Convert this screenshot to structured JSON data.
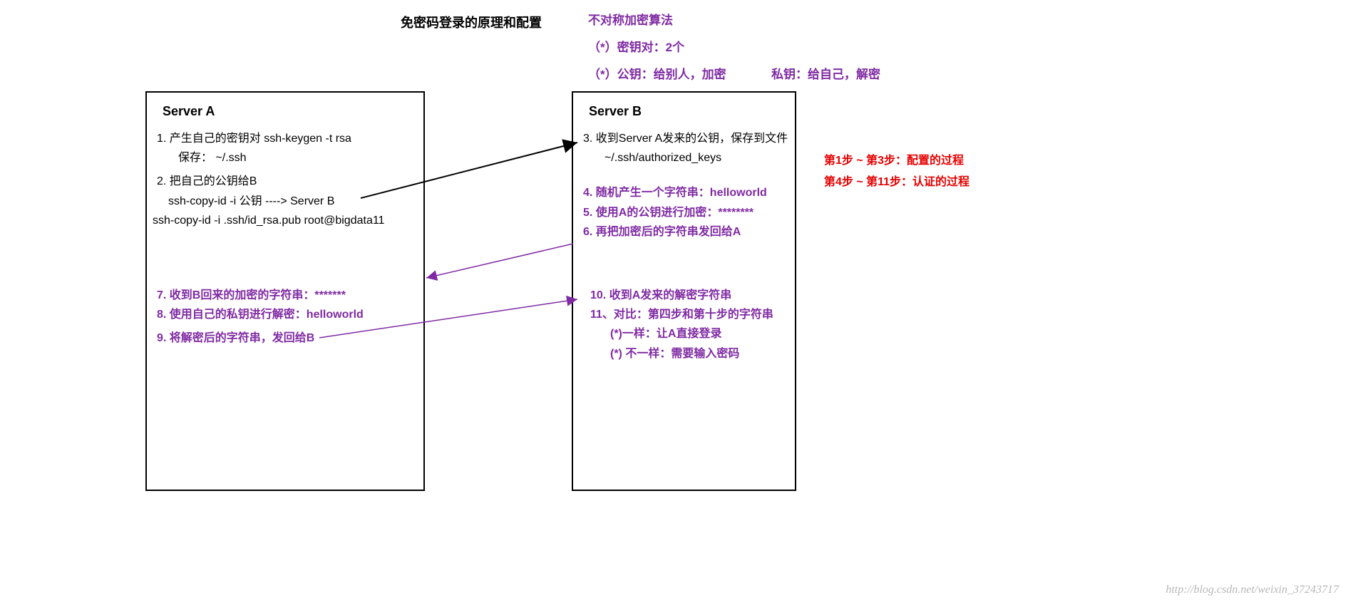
{
  "title": "免密码登录的原理和配置",
  "top_notes": {
    "line1": "不对称加密算法",
    "line2": "（*）密钥对：2个",
    "line3a": "（*）公钥：给别人，加密",
    "line3b": "私钥：给自己，解密"
  },
  "server_a": {
    "title": "Server A",
    "s1": "1. 产生自己的密钥对 ssh-keygen -t rsa",
    "s1a": "保存：  ~/.ssh",
    "s2": "2. 把自己的公钥给B",
    "s2a": "ssh-copy-id -i 公钥 ---->   Server B",
    "s2b": "ssh-copy-id -i .ssh/id_rsa.pub root@bigdata11",
    "s7": "7. 收到B回来的加密的字符串：*******",
    "s8": "8. 使用自己的私钥进行解密：helloworld",
    "s9": "9. 将解密后的字符串，发回给B"
  },
  "server_b": {
    "title": "Server B",
    "s3": "3. 收到Server A发来的公钥，保存到文件",
    "s3a": "~/.ssh/authorized_keys",
    "s4": "4. 随机产生一个字符串：helloworld",
    "s5": "5. 使用A的公钥进行加密：********",
    "s6": "6. 再把加密后的字符串发回给A",
    "s10": "10. 收到A发来的解密字符串",
    "s11": "11、对比：第四步和第十步的字符串",
    "s11a": "(*)一样：让A直接登录",
    "s11b": "(*) 不一样：需要输入密码"
  },
  "red_notes": {
    "r1": "第1步 ~ 第3步：配置的过程",
    "r2": "第4步 ~ 第11步：认证的过程"
  },
  "watermark": "http://blog.csdn.net/weixin_37243717"
}
